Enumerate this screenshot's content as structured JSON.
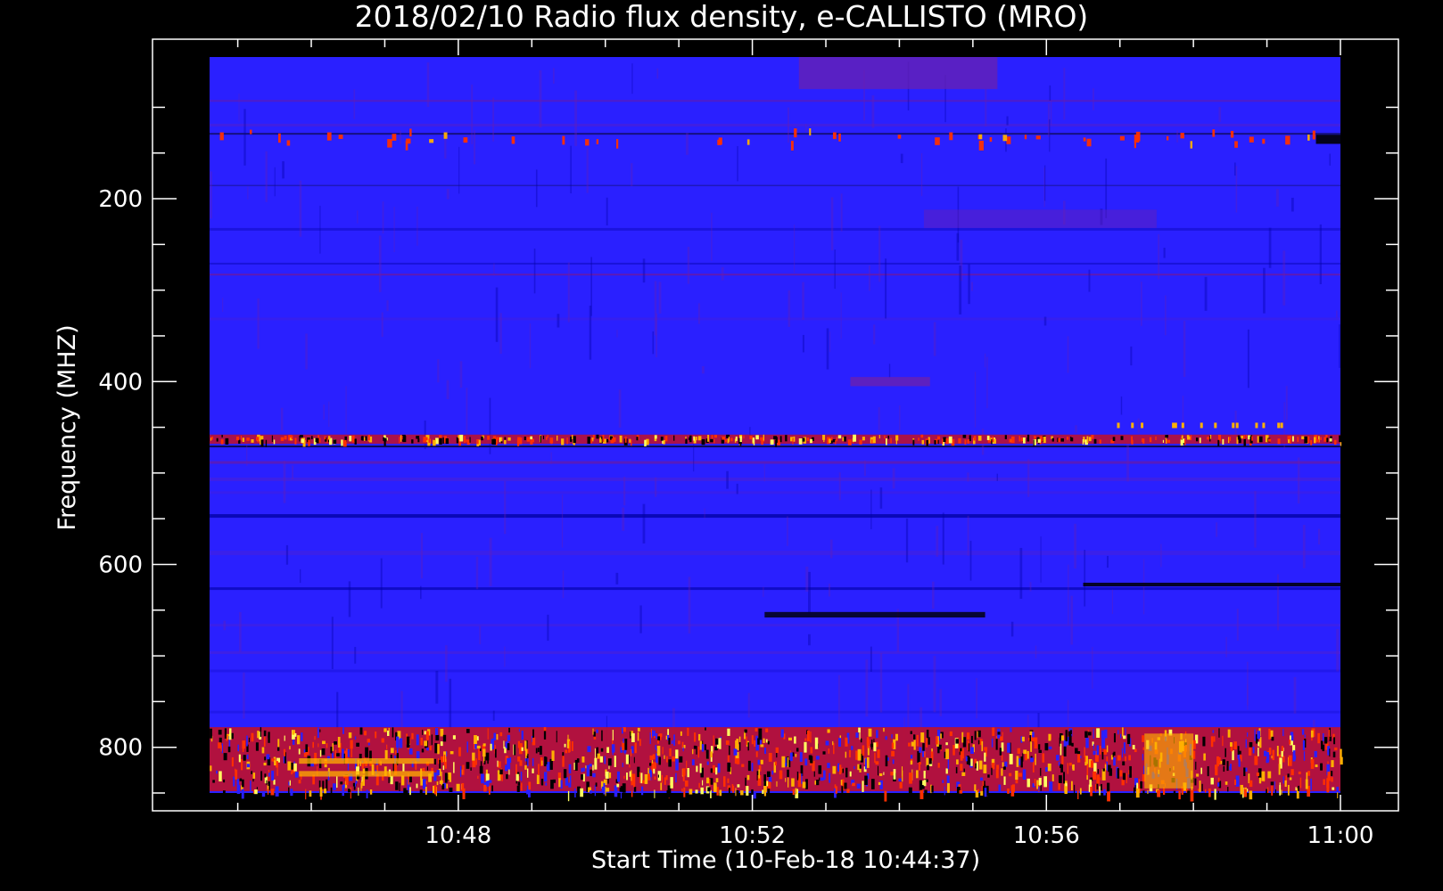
{
  "chart_data": {
    "type": "heatmap",
    "title": "2018/02/10  Radio flux density, e-CALLISTO (MRO)",
    "xlabel": "Start Time (10-Feb-18 10:44:37)",
    "ylabel": "Frequency (MHZ)",
    "x_unit": "time of day (hh:mm)",
    "xlim": [
      "10:44:37",
      "11:00:00"
    ],
    "ylim": [
      850,
      45
    ],
    "y_inverted": true,
    "xticks": [
      "10:48",
      "10:52",
      "10:56",
      "11:00"
    ],
    "yticks": [
      200,
      400,
      600,
      800
    ],
    "colorscale": [
      "#000000",
      "#0000a0",
      "#2a1fff",
      "#6a20b0",
      "#c0102a",
      "#ff3000",
      "#ffb000",
      "#ffff60"
    ],
    "background_level": "blue",
    "features": [
      {
        "kind": "band",
        "freq_mhz": 463,
        "intensity": "high",
        "note": "narrow persistent interference line"
      },
      {
        "kind": "band",
        "freq_range_mhz": [
          778,
          848
        ],
        "intensity": "very high",
        "note": "broad band of strong emission"
      },
      {
        "kind": "band",
        "freq_mhz": 130,
        "intensity": "medium",
        "note": "intermittent bright dots"
      },
      {
        "kind": "band",
        "freq_mhz": 220,
        "intensity": "low",
        "note": "faint reddish streak, 10:54-10:57"
      },
      {
        "kind": "band",
        "freq_range_mhz": [
          45,
          80
        ],
        "intensity": "low",
        "note": "reddish block near 10:53-10:54"
      },
      {
        "kind": "dark_line",
        "freq_mhz": 545,
        "note": "darker absorption-like lane"
      },
      {
        "kind": "dark_line",
        "freq_mhz": 622,
        "note": "dark lane, strongest near 11:00"
      },
      {
        "kind": "dark_line",
        "freq_mhz": 655,
        "note": "dark lane 10:52-10:55"
      }
    ]
  }
}
